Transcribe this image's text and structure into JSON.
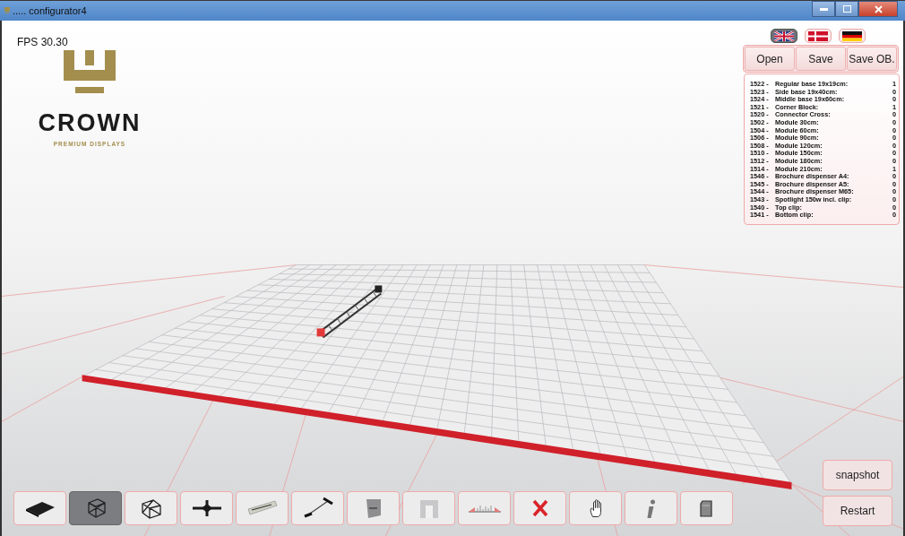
{
  "window": {
    "title": "..... configurator4"
  },
  "fps": "FPS 30.30",
  "logo": {
    "name": "CROWN",
    "tagline": "PREMIUM DISPLAYS"
  },
  "languages": [
    {
      "kind": "uk",
      "selected": true
    },
    {
      "kind": "dk",
      "selected": false
    },
    {
      "kind": "de",
      "selected": false
    }
  ],
  "file_buttons": [
    "Open",
    "Save",
    "Save OB."
  ],
  "parts": [
    {
      "code": "1522 -",
      "name": "Regular base 19x19cm:",
      "count": "1"
    },
    {
      "code": "1523 -",
      "name": "Side base 19x40cm:",
      "count": "0"
    },
    {
      "code": "1524 -",
      "name": "Middle base 19x60cm:",
      "count": "0"
    },
    {
      "code": "1521 -",
      "name": "Corner Block:",
      "count": "1"
    },
    {
      "code": "1520 -",
      "name": "Connector Cross:",
      "count": "0"
    },
    {
      "code": "1502 -",
      "name": "Module 30cm:",
      "count": "0"
    },
    {
      "code": "1504 -",
      "name": "Module 60cm:",
      "count": "0"
    },
    {
      "code": "1506 -",
      "name": "Module 90cm:",
      "count": "0"
    },
    {
      "code": "1508 -",
      "name": "Module 120cm:",
      "count": "0"
    },
    {
      "code": "1510 -",
      "name": "Module 150cm:",
      "count": "0"
    },
    {
      "code": "1512 -",
      "name": "Module 180cm:",
      "count": "0"
    },
    {
      "code": "1514 -",
      "name": "Module 210cm:",
      "count": "1"
    },
    {
      "code": "1546 -",
      "name": "Brochure dispenser A4:",
      "count": "0"
    },
    {
      "code": "1545 -",
      "name": "Brochure dispenser A5:",
      "count": "0"
    },
    {
      "code": "1544 -",
      "name": "Brochure dispenser M65:",
      "count": "0"
    },
    {
      "code": "1543 -",
      "name": "Spotlight 150w incl. clip:",
      "count": "0"
    },
    {
      "code": "1540 -",
      "name": "Top clip:",
      "count": "0"
    },
    {
      "code": "1541 -",
      "name": "Bottom clip:",
      "count": "0"
    }
  ],
  "tools": [
    {
      "kind": "plate",
      "selected": false
    },
    {
      "kind": "cube",
      "selected": true
    },
    {
      "kind": "truss",
      "selected": false
    },
    {
      "kind": "cross",
      "selected": false
    },
    {
      "kind": "tube",
      "selected": false
    },
    {
      "kind": "arm",
      "selected": false
    },
    {
      "kind": "panel",
      "selected": false
    },
    {
      "kind": "wall",
      "selected": false
    },
    {
      "kind": "ruler",
      "selected": false
    },
    {
      "kind": "delete",
      "selected": false
    },
    {
      "kind": "hand",
      "selected": false
    },
    {
      "kind": "info",
      "selected": false
    },
    {
      "kind": "document",
      "selected": false
    }
  ],
  "side_buttons": [
    "snapshot",
    "Restart"
  ]
}
